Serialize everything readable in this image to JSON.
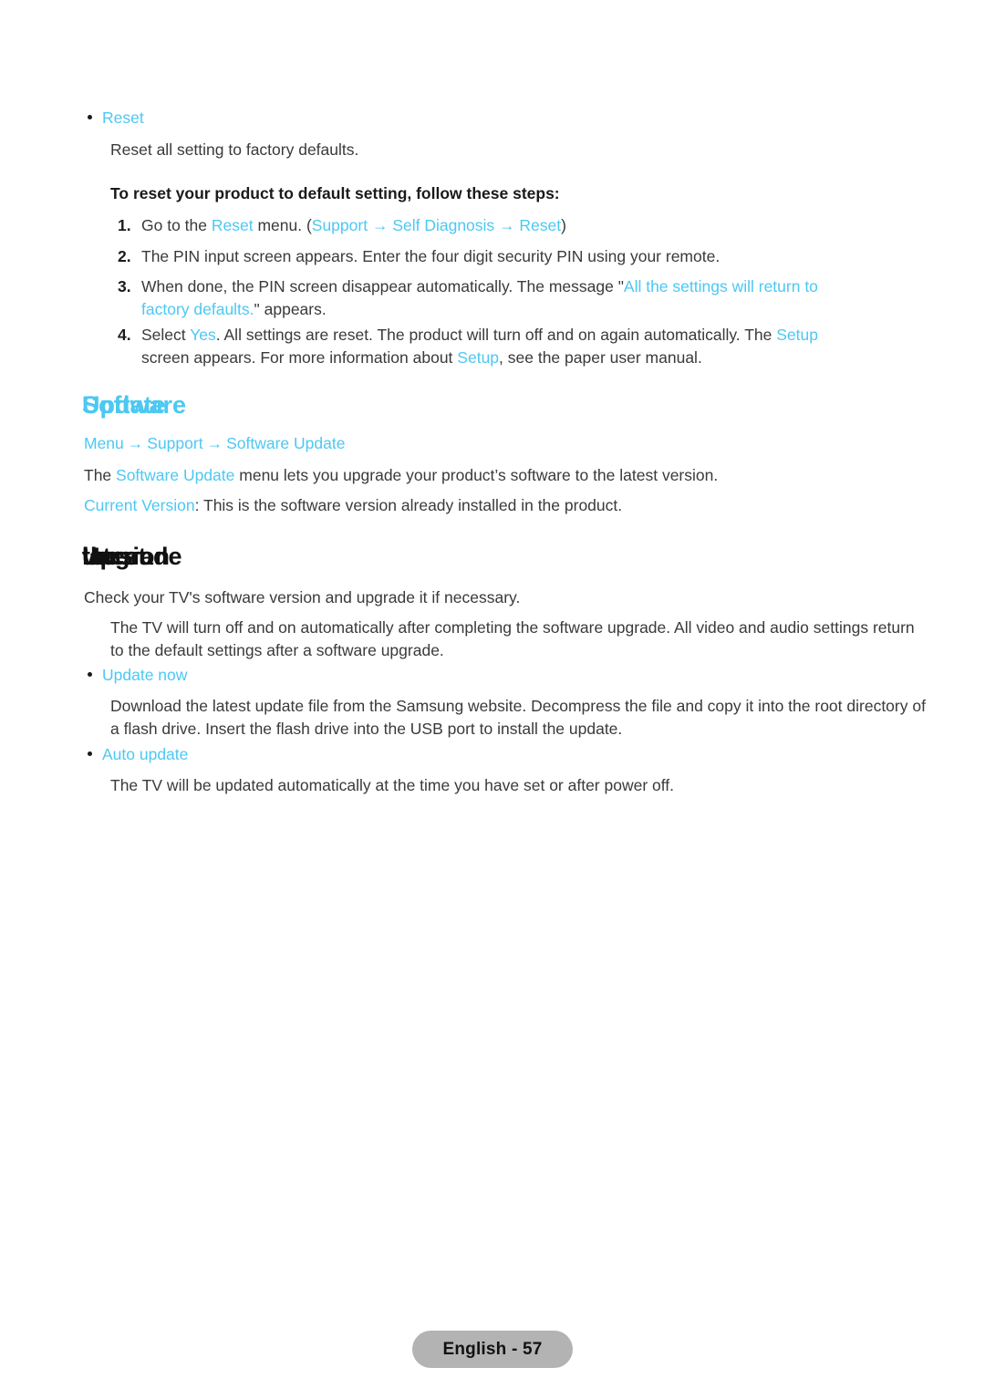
{
  "page": {
    "language_footer": "English - 57",
    "accent_color": "#4cc8f2",
    "body_color": "#3a3a3a",
    "footer_badge_color": "#b3b3b3"
  },
  "reset_section": {
    "bullet_label": "Reset",
    "description": "Reset all setting to factory defaults.",
    "instructions_heading": "To reset your product to default setting, follow these steps:",
    "steps": [
      {
        "number": "1.",
        "parts": [
          {
            "text": "Go to the ",
            "cyan": false
          },
          {
            "text": "Reset",
            "cyan": true
          },
          {
            "text": " menu. (",
            "cyan": false
          },
          {
            "text": "Support",
            "cyan": true
          },
          {
            "text": " → ",
            "cyan": true
          },
          {
            "text": "Self Diagnosis",
            "cyan": true
          },
          {
            "text": " → ",
            "cyan": true
          },
          {
            "text": "Reset",
            "cyan": true
          },
          {
            "text": ")",
            "cyan": false
          }
        ]
      },
      {
        "number": "2.",
        "parts": [
          {
            "text": "The PIN input screen appears. Enter the four digit security PIN using your remote.",
            "cyan": false
          }
        ]
      },
      {
        "number": "3.",
        "parts": [
          {
            "text": "When done, the PIN screen disappear automatically. The message \"",
            "cyan": false
          },
          {
            "text": "All the settings will return to factory defaults.",
            "cyan": true
          },
          {
            "text": "\" appears.",
            "cyan": false
          }
        ]
      },
      {
        "number": "4.",
        "parts": [
          {
            "text": "Select ",
            "cyan": false
          },
          {
            "text": "Yes",
            "cyan": true
          },
          {
            "text": ". All settings are reset. The product will turn off and on again automatically. The ",
            "cyan": false
          },
          {
            "text": "Setup",
            "cyan": true
          },
          {
            "text": " screen appears. For more information about ",
            "cyan": false
          },
          {
            "text": "Setup",
            "cyan": true
          },
          {
            "text": ", see the paper user manual.",
            "cyan": false
          }
        ]
      }
    ]
  },
  "software_update_section": {
    "heading_words": [
      "Software",
      "Update"
    ],
    "breadcrumb": [
      "Menu",
      "Support",
      "Software Update"
    ],
    "breadcrumb_arrow": "→",
    "intro_parts": [
      {
        "text": "The ",
        "cyan": false
      },
      {
        "text": "Software Update",
        "cyan": true
      },
      {
        "text": " menu lets you upgrade your product’s software to the latest version.",
        "cyan": false
      }
    ],
    "current_version_parts": [
      {
        "text": "Current Version",
        "cyan": true
      },
      {
        "text": ": This is the software version already installed in the product.",
        "cyan": false
      }
    ]
  },
  "upgrade_section": {
    "heading_words": [
      "Upgrade",
      "to",
      "the",
      "latest",
      "version"
    ],
    "intro": "Check your TV's software version and upgrade it if necessary.",
    "note": "The TV will turn off and on automatically after completing the software upgrade. All video and audio settings return to the default settings after a software upgrade.",
    "items": [
      {
        "label": "Update now",
        "description": "Download the latest update file from the Samsung website. Decompress the file and copy it into the root directory of a flash drive. Insert the flash drive into the USB port to install the update."
      },
      {
        "label": "Auto update",
        "description": "The TV will be updated automatically at the time you have set or after power off."
      }
    ]
  }
}
